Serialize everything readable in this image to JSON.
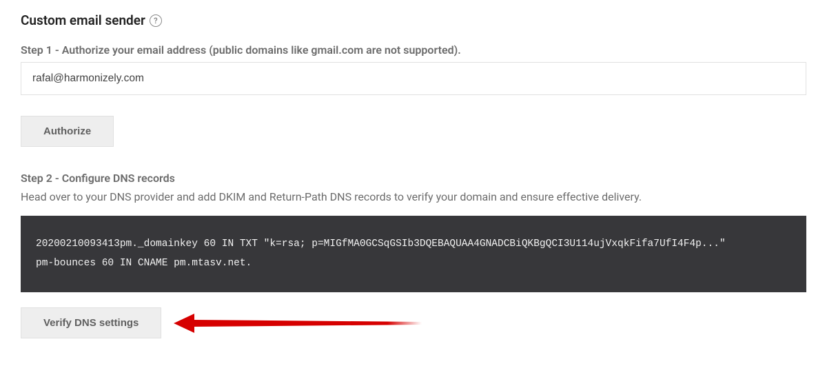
{
  "section": {
    "title": "Custom email sender"
  },
  "step1": {
    "label": "Step 1 - Authorize your email address (public domains like gmail.com are not supported).",
    "email_value": "rafal@harmonizely.com",
    "authorize_label": "Authorize"
  },
  "step2": {
    "label": "Step 2 - Configure DNS records",
    "description": "Head over to your DNS provider and add DKIM and Return-Path DNS records to verify your domain and ensure effective delivery.",
    "dns_records": "20200210093413pm._domainkey 60 IN TXT \"k=rsa; p=MIGfMA0GCSqGSIb3DQEBAQUAA4GNADCBiQKBgQCI3U114ujVxqkFifa7UfI4F4p...\"\npm-bounces 60 IN CNAME pm.mtasv.net.",
    "verify_label": "Verify DNS settings"
  },
  "colors": {
    "arrow": "#d60000"
  }
}
